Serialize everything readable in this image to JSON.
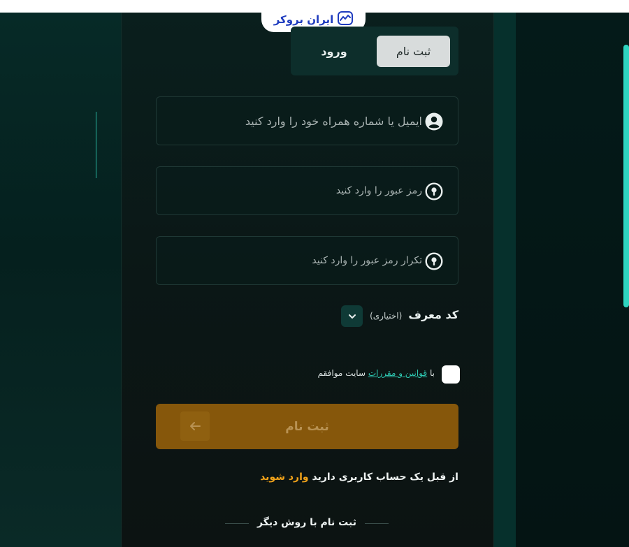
{
  "brand": {
    "logo_text": "ایران بروکر",
    "logo_icon": "chart-wave-icon",
    "accent_color": "#1f3cbf"
  },
  "tabs": {
    "register_label": "ثبت نام",
    "login_label": "ورود"
  },
  "form": {
    "email_placeholder": "ایمیل یا شماره همراه خود را وارد کنید",
    "password_placeholder": "رمز عبور را وارد کنید",
    "password_repeat_placeholder": "تکرار رمز عبور را وارد کنید",
    "referral_label": "کد معرف",
    "referral_optional": "(اختیاری)",
    "terms_prefix": "با",
    "terms_link": "قوانین و مقررات",
    "terms_suffix": "سایت موافقم",
    "submit_label": "ثبت نام",
    "submit_color": "#86570b"
  },
  "footer": {
    "have_account_text": "از قبل یک حساب کاربری دارید",
    "login_link": "وارد شوید",
    "login_link_color": "#f0a21a",
    "other_method": "ثبت نام با روش دیگر"
  }
}
